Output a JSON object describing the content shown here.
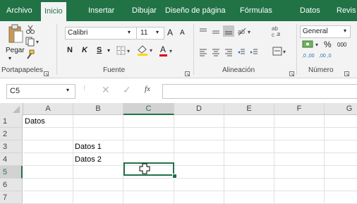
{
  "ribbon": {
    "tabs": [
      "Archivo",
      "Inicio",
      "Insertar",
      "Dibujar",
      "Diseño de página",
      "Fórmulas",
      "Datos",
      "Revis"
    ],
    "active_tab": "Inicio",
    "clipboard": {
      "paste_label": "Pegar",
      "group_label": "Portapapeles"
    },
    "font": {
      "name": "Calibri",
      "size": "11",
      "bold": "N",
      "italic": "K",
      "underline": "S",
      "grow": "A",
      "shrink": "A",
      "color_letter": "A",
      "group_label": "Fuente"
    },
    "alignment": {
      "group_label": "Alineación"
    },
    "number": {
      "format": "General",
      "percent": "%",
      "thousands": "000",
      "inc_dec": ",0 ,00",
      "dec_dec": ",00 ,0",
      "group_label": "Número"
    }
  },
  "formula_bar": {
    "name_box": "C5",
    "fx": "fx",
    "content": ""
  },
  "sheet": {
    "columns": [
      "A",
      "B",
      "C",
      "D",
      "E",
      "F",
      "G"
    ],
    "rows": [
      "1",
      "2",
      "3",
      "4",
      "5",
      "6",
      "7"
    ],
    "selected_column": "C",
    "selected_row": "5",
    "cells": {
      "A1": "Datos",
      "B3": "Datos 1",
      "B4": "Datos 2"
    }
  },
  "colors": {
    "accent": "#217346"
  }
}
